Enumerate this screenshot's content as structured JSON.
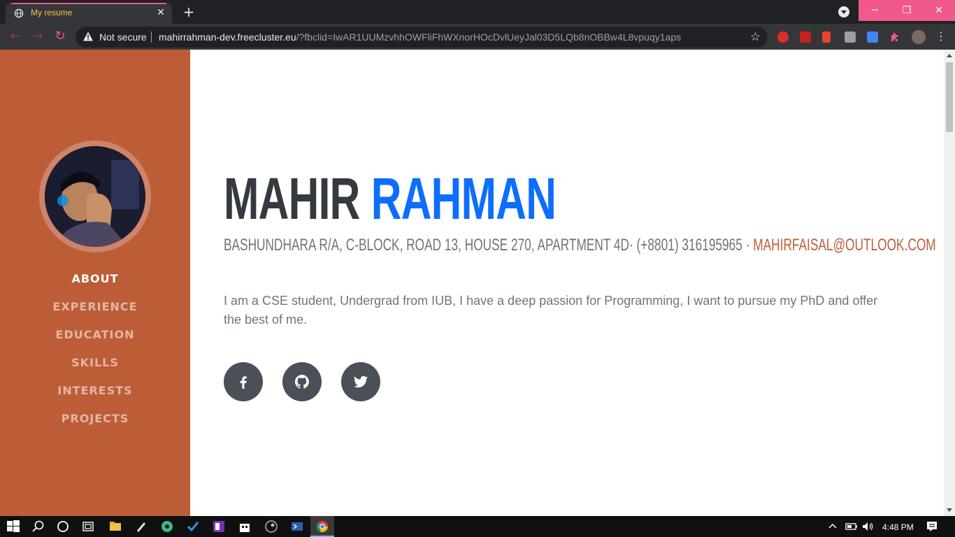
{
  "browser": {
    "tab_title": "My resume",
    "tab_close": "✕",
    "new_tab": "+",
    "window_buttons": {
      "minimize": "─",
      "restore": "❐",
      "close": "✕"
    },
    "security_label": "Not secure",
    "url_host": "mahirrahman-dev.freecluster.eu",
    "url_rest": "/?fbclid=IwAR1UUMzvhhOWFliFhWXnorHOcDvlUeyJal03D5LQb8nOBBw4L8vpuqy1aps",
    "bookmark_star": "☆",
    "menu": "⋮",
    "nav": {
      "back": "←",
      "forward": "→",
      "reload": "↻"
    }
  },
  "sidebar": {
    "nav_items": [
      {
        "label": "ABOUT",
        "active": true
      },
      {
        "label": "EXPERIENCE",
        "active": false
      },
      {
        "label": "EDUCATION",
        "active": false
      },
      {
        "label": "SKILLS",
        "active": false
      },
      {
        "label": "INTERESTS",
        "active": false
      },
      {
        "label": "PROJECTS",
        "active": false
      }
    ]
  },
  "about": {
    "first_name": "MAHIR",
    "last_name": "RAHMAN",
    "address_phone": "BASHUNDHARA R/A, C-BLOCK, ROAD 13, HOUSE 270, APARTMENT 4D· (+8801) 316195965 · ",
    "email": "MAHIRFAISAL@OUTLOOK.COM",
    "bio": "I am a CSE student, Undergrad from IUB, I have a deep passion for Programming, I want to pursue my PhD and offer the best of me.",
    "social": [
      "facebook-icon",
      "github-icon",
      "twitter-icon"
    ]
  },
  "taskbar": {
    "clock": "4:48 PM"
  },
  "colors": {
    "sidebar": "#bd5d38",
    "name_first": "#343a40",
    "name_last": "#0d6efd",
    "email": "#bd5d38",
    "tab_accent": "#f1598a"
  }
}
